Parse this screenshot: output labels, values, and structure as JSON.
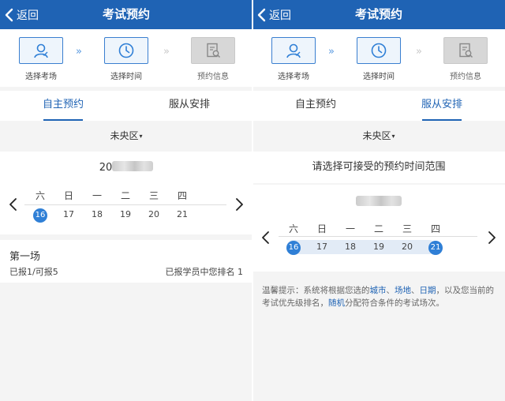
{
  "header": {
    "back_label": "返回",
    "title": "考试预约"
  },
  "steps": [
    {
      "label": "选择考场"
    },
    {
      "label": "选择时间"
    },
    {
      "label": "预约信息"
    }
  ],
  "step_arrow": "»",
  "tabs": [
    {
      "label": "自主预约"
    },
    {
      "label": "服从安排"
    }
  ],
  "district": {
    "value": "未央区",
    "caret": "▾"
  },
  "left": {
    "year_prefix": "20",
    "weekdays": [
      "六",
      "日",
      "一",
      "二",
      "三",
      "四"
    ],
    "dates": [
      "16",
      "17",
      "18",
      "19",
      "20",
      "21"
    ],
    "selected_date": "16",
    "session": {
      "title": "第一场",
      "quota": "已报1/可报5",
      "rank": "已报学员中您排名  1"
    }
  },
  "right": {
    "range_title": "请选择可接受的预约时间范围",
    "weekdays": [
      "六",
      "日",
      "一",
      "二",
      "三",
      "四"
    ],
    "dates": [
      "16",
      "17",
      "18",
      "19",
      "20",
      "21"
    ],
    "range_start": "16",
    "range_end": "21",
    "tip": {
      "p1": "温馨提示：系统将根据您选的",
      "city": "城市",
      "sep1": "、",
      "venue": "场地",
      "sep2": "、",
      "date": "日期",
      "p2": "，以及您当前的考试优先级排名，",
      "random": "随机",
      "p3": "分配符合条件的考试场次。"
    }
  },
  "colors": {
    "header_bg": "#1f63b4",
    "accent": "#2f7fd6",
    "range_band": "#e2ebf6"
  },
  "icons": [
    "chevron-left-icon",
    "person-icon",
    "clock-icon",
    "document-search-icon",
    "chevron-right-icon",
    "caret-down-icon"
  ]
}
